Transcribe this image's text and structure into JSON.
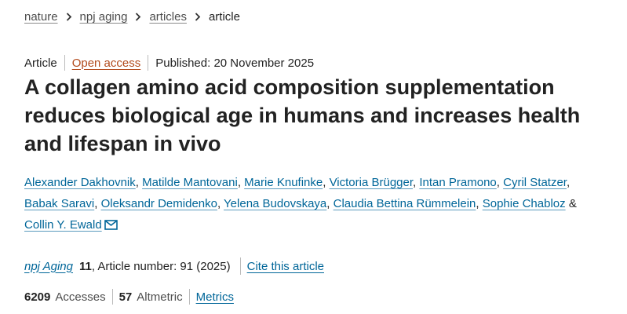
{
  "breadcrumb": {
    "items": [
      "nature",
      "npj aging",
      "articles"
    ],
    "current": "article"
  },
  "meta": {
    "type": "Article",
    "access": "Open access",
    "published": "Published: 20 November 2025"
  },
  "title": "A collagen amino acid composition supplementation reduces biological age in humans and increases health and lifespan in vivo",
  "authors": [
    "Alexander Dakhovnik",
    "Matilde Mantovani",
    "Marie Knufinke",
    "Victoria Brügger",
    "Intan Pramono",
    "Cyril Statzer",
    "Babak Saravi",
    "Oleksandr Demidenko",
    "Yelena Budovskaya",
    "Claudia Bettina Rümmelein",
    "Sophie Chabloz",
    "Collin Y. Ewald"
  ],
  "authors_conjunction": "&",
  "citation": {
    "journal": "npj Aging",
    "volume": "11",
    "article_number": ", Article number: 91 (2025)",
    "cite_link": "Cite this article"
  },
  "metrics": {
    "accesses_count": "6209",
    "accesses_label": "Accesses",
    "altmetric_count": "57",
    "altmetric_label": "Altmetric",
    "metrics_link": "Metrics"
  },
  "colors": {
    "link": "#006699",
    "open_access": "#b24a1c",
    "text": "#222222"
  }
}
